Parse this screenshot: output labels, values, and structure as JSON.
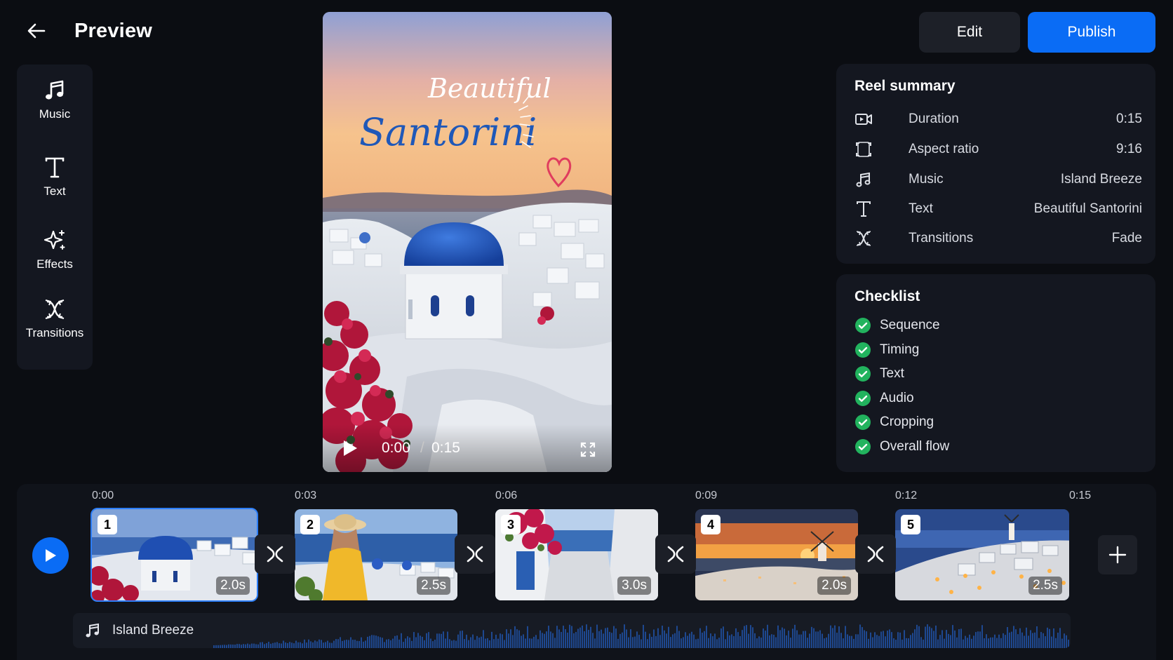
{
  "header": {
    "title": "Preview",
    "edit_label": "Edit",
    "publish_label": "Publish"
  },
  "tools": [
    {
      "label": "Music",
      "icon": "music-icon"
    },
    {
      "label": "Text",
      "icon": "text-icon"
    },
    {
      "label": "Effects",
      "icon": "sparkle-icon"
    },
    {
      "label": "Transitions",
      "icon": "transitions-icon"
    }
  ],
  "video": {
    "title_script_line1": "Beautiful",
    "title_script_line2": "Santorini",
    "current_time": "0:00",
    "separator": "/",
    "total_time": "0:15"
  },
  "summary": {
    "title": "Reel summary",
    "rows": [
      {
        "icon": "video-camera-icon",
        "label": "Duration",
        "value": "0:15"
      },
      {
        "icon": "aspect-ratio-icon",
        "label": "Aspect ratio",
        "value": "9:16"
      },
      {
        "icon": "music-icon",
        "label": "Music",
        "value": "Island Breeze"
      },
      {
        "icon": "text-icon",
        "label": "Text",
        "value": "Beautiful Santorini"
      },
      {
        "icon": "transitions-icon",
        "label": "Transitions",
        "value": "Fade"
      }
    ]
  },
  "checklist": {
    "title": "Checklist",
    "items": [
      "Sequence",
      "Timing",
      "Text",
      "Audio",
      "Cropping",
      "Overall flow"
    ],
    "check_color": "#22b35e"
  },
  "timeline": {
    "ticks": [
      "0:00",
      "0:03",
      "0:06",
      "0:09",
      "0:12",
      "0:15"
    ],
    "clips": [
      {
        "number": "1",
        "duration": "2.0s",
        "selected": true
      },
      {
        "number": "2",
        "duration": "2.5s",
        "selected": false
      },
      {
        "number": "3",
        "duration": "3.0s",
        "selected": false
      },
      {
        "number": "4",
        "duration": "2.0s",
        "selected": false
      },
      {
        "number": "5",
        "duration": "2.5s",
        "selected": false
      }
    ],
    "audio_track": "Island Breeze"
  },
  "colors": {
    "accent": "#0a6cf5",
    "background": "#0b0d12",
    "panel": "#141720"
  }
}
